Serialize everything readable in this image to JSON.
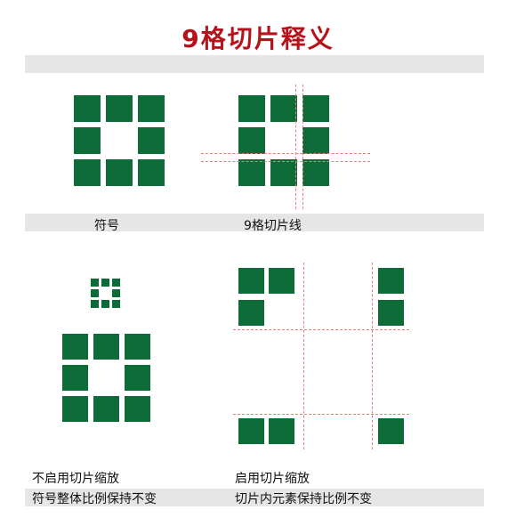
{
  "title": "9格切片释义",
  "labels": {
    "symbol": "符号",
    "slice_lines": "9格切片线",
    "no_scale_1": "不启用切片缩放",
    "no_scale_2": "符号整体比例保持不变",
    "scale_1": "启用切片缩放",
    "scale_2": "切片内元素保持比例不变"
  },
  "colors": {
    "title": "#b5121b",
    "tile": "#0c6b36",
    "guide": "#e57f7f",
    "band": "#e6e6e6"
  }
}
